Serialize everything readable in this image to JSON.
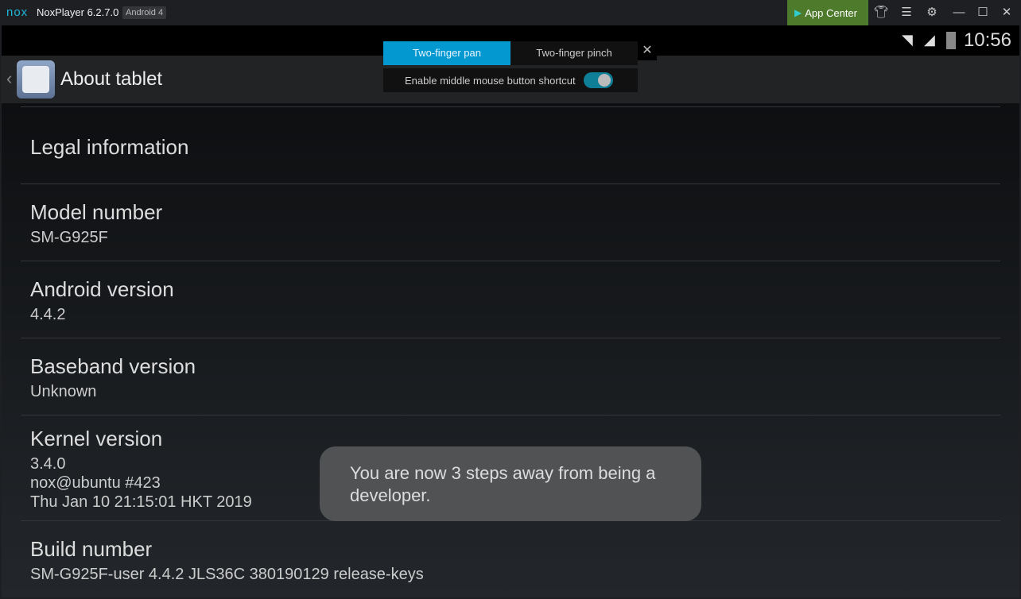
{
  "titlebar": {
    "logo": "nox",
    "title": "NoxPlayer 6.2.7.0",
    "badge": "Android 4",
    "app_center": "App Center"
  },
  "statusbar": {
    "time": "10:56"
  },
  "actionbar": {
    "back": "‹",
    "title": "About tablet"
  },
  "popup": {
    "tabs": [
      "Two-finger pan",
      "Two-finger pinch"
    ],
    "option": "Enable middle mouse button shortcut",
    "toggle_on": true
  },
  "rows": [
    {
      "title": "Legal information"
    },
    {
      "title": "Model number",
      "sub": [
        "SM-G925F"
      ]
    },
    {
      "title": "Android version",
      "sub": [
        "4.4.2"
      ]
    },
    {
      "title": "Baseband version",
      "sub": [
        "Unknown"
      ]
    },
    {
      "title": "Kernel version",
      "sub": [
        "3.4.0",
        "nox@ubuntu #423",
        "Thu Jan 10 21:15:01 HKT 2019"
      ]
    },
    {
      "title": "Build number",
      "sub": [
        "SM-G925F-user 4.4.2 JLS36C 380190129 release-keys"
      ]
    }
  ],
  "toast": "You are now 3 steps away from being a developer."
}
